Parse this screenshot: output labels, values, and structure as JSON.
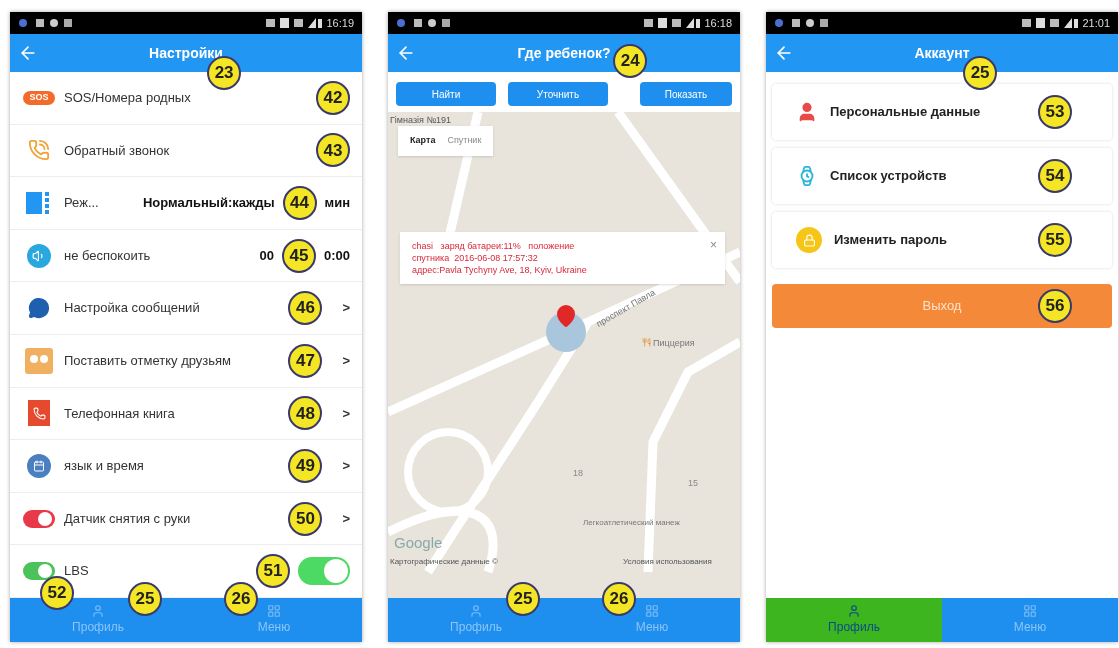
{
  "screens": [
    {
      "kind": "settings",
      "status_time": "16:19",
      "title": "Настройки",
      "title_callout": "23",
      "rows": [
        {
          "kind": "sos",
          "icon_text": "SOS",
          "label": "SOS/Номера родных",
          "callout": "42"
        },
        {
          "kind": "callback",
          "label": "Обратный звонок",
          "callout": "43"
        },
        {
          "kind": "mode",
          "label": "Реж...",
          "value": "Нормальный:кажды",
          "callout": "44",
          "value_after": "мин"
        },
        {
          "kind": "dnd",
          "label": "не беспокоить",
          "value": "00",
          "callout": "45",
          "value_after": "0:00"
        },
        {
          "kind": "message",
          "label": "Настройка сообщений",
          "callout": "46",
          "arrow": ">"
        },
        {
          "kind": "friends",
          "label": "Поставить отметку друзьям",
          "callout": "47",
          "arrow": ">"
        },
        {
          "kind": "phonebook",
          "label": "Телефонная книга",
          "callout": "48",
          "arrow": ">"
        },
        {
          "kind": "language",
          "label": "язык и время",
          "callout": "49",
          "arrow": ">"
        },
        {
          "kind": "wrist",
          "label": "Датчик снятия с руки",
          "callout": "50",
          "arrow": ">"
        },
        {
          "kind": "lbs",
          "label": "LBS",
          "callout": "51",
          "switch": {
            "on": true
          }
        }
      ],
      "nav": {
        "leading_callout": "52",
        "items": [
          {
            "kind": "profile",
            "label": "Профиль",
            "selected": false,
            "callout": "25"
          },
          {
            "kind": "menu",
            "label": "Меню",
            "selected": false,
            "callout": "26"
          }
        ]
      }
    },
    {
      "kind": "map",
      "status_time": "16:18",
      "title": "Где ребенок?",
      "title_callout": "24",
      "buttons": [
        {
          "label": "Найти"
        },
        {
          "label": "Уточнить"
        },
        {
          "label": "Показать"
        }
      ],
      "map": {
        "layers": [
          {
            "label": "Карта",
            "selected": true
          },
          {
            "label": "Спутник",
            "selected": false
          }
        ],
        "labels": [
          {
            "kind": "poi",
            "text": "Гімназія №191"
          },
          {
            "kind": "street",
            "text": "проспект Павла"
          },
          {
            "kind": "restaurant",
            "text": "Пиццерия"
          },
          {
            "kind": "building",
            "text": "18"
          },
          {
            "kind": "building2",
            "text": "15"
          },
          {
            "kind": "landmark",
            "text": "Легкоатлетический манеж"
          },
          {
            "kind": "logo",
            "text": "Google"
          },
          {
            "kind": "attribution",
            "text": "Картографические данные ©"
          },
          {
            "kind": "terms",
            "text": "Условия использования"
          }
        ],
        "info": {
          "lines": [
            "chasi   заряд батареи:11%   положение",
            "спутника  2016-06-08 17:57:32",
            "адрес:Pavla Tychyny Ave, 18, Kyiv, Ukraine"
          ],
          "close": "×"
        }
      },
      "nav": {
        "items": [
          {
            "kind": "profile",
            "label": "Профиль",
            "selected": false,
            "callout": "25"
          },
          {
            "kind": "menu",
            "label": "Меню",
            "selected": false,
            "callout": "26"
          }
        ]
      }
    },
    {
      "kind": "account",
      "status_time": "21:01",
      "title": "Аккаунт",
      "title_callout": "25",
      "items": [
        {
          "kind": "personal",
          "label": "Персональные данные",
          "callout": "53"
        },
        {
          "kind": "devices",
          "label": "Список устройств",
          "callout": "54"
        },
        {
          "kind": "password",
          "label": "Изменить пароль",
          "callout": "55"
        }
      ],
      "logout": {
        "label": "Выход",
        "callout": "56"
      },
      "nav": {
        "items": [
          {
            "kind": "profile",
            "label": "Профиль",
            "selected": true
          },
          {
            "kind": "menu",
            "label": "Меню",
            "selected": false
          }
        ]
      }
    }
  ]
}
